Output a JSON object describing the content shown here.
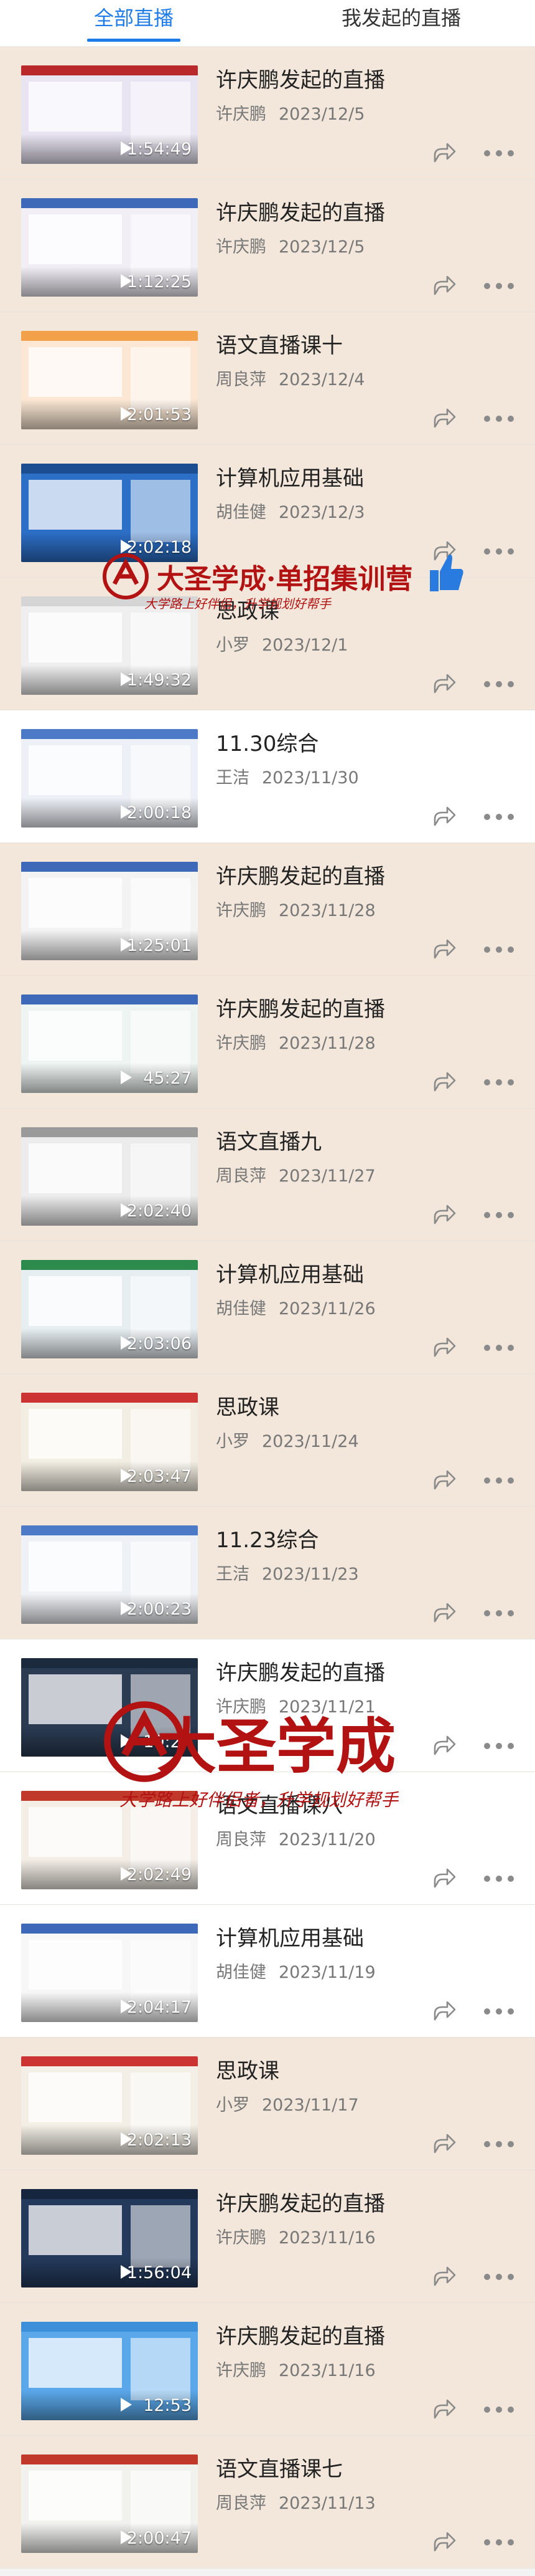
{
  "tabs": [
    {
      "label": "全部直播",
      "active": true
    },
    {
      "label": "我发起的直播",
      "active": false
    }
  ],
  "colors": {
    "accent": "#1e7ce8",
    "item_bg": "#f2e7da",
    "item_bg_alt": "#ffffff",
    "watermark": "#b31212"
  },
  "items": [
    {
      "title": "许庆鹏发起的直播",
      "author": "许庆鹏",
      "date": "2023/12/5",
      "duration": "1:54:49",
      "bg": "#f2e7da",
      "thumb": "#e8e4f2",
      "bar": "#b9292b"
    },
    {
      "title": "许庆鹏发起的直播",
      "author": "许庆鹏",
      "date": "2023/12/5",
      "duration": "1:12:25",
      "bg": "#f2e7da",
      "thumb": "#f1eef6",
      "bar": "#3d69b8"
    },
    {
      "title": "语文直播课十",
      "author": "周良萍",
      "date": "2023/12/4",
      "duration": "2:01:53",
      "bg": "#f2e7da",
      "thumb": "#fbe7d3",
      "bar": "#f3a04b"
    },
    {
      "title": "计算机应用基础",
      "author": "胡佳健",
      "date": "2023/12/3",
      "duration": "2:02:18",
      "bg": "#f2e7da",
      "thumb": "#2c6fc7",
      "bar": "#1c4d91"
    },
    {
      "title": "思政课",
      "author": "小罗",
      "date": "2023/12/1",
      "duration": "1:49:32",
      "bg": "#f2e7da",
      "thumb": "#efefef",
      "bar": "#d5d5d5"
    },
    {
      "title": "11.30综合",
      "author": "王洁",
      "date": "2023/11/30",
      "duration": "2:00:18",
      "bg": "#ffffff",
      "thumb": "#edf1f7",
      "bar": "#4c7ac7"
    },
    {
      "title": "许庆鹏发起的直播",
      "author": "许庆鹏",
      "date": "2023/11/28",
      "duration": "1:25:01",
      "bg": "#f2e7da",
      "thumb": "#f3f3f3",
      "bar": "#3d69b8"
    },
    {
      "title": "许庆鹏发起的直播",
      "author": "许庆鹏",
      "date": "2023/11/28",
      "duration": "45:27",
      "bg": "#f2e7da",
      "thumb": "#eef4f2",
      "bar": "#3d69b8"
    },
    {
      "title": "语文直播九",
      "author": "周良萍",
      "date": "2023/11/27",
      "duration": "2:02:40",
      "bg": "#f2e7da",
      "thumb": "#ececec",
      "bar": "#9a9a9a"
    },
    {
      "title": "计算机应用基础",
      "author": "胡佳健",
      "date": "2023/11/26",
      "duration": "2:03:06",
      "bg": "#f2e7da",
      "thumb": "#e7eef2",
      "bar": "#2c8a4c"
    },
    {
      "title": "思政课",
      "author": "小罗",
      "date": "2023/11/24",
      "duration": "2:03:47",
      "bg": "#f2e7da",
      "thumb": "#f3eee3",
      "bar": "#cc3333"
    },
    {
      "title": "11.23综合",
      "author": "王洁",
      "date": "2023/11/23",
      "duration": "2:00:23",
      "bg": "#f2e7da",
      "thumb": "#eef1f5",
      "bar": "#4c7ac7"
    },
    {
      "title": "许庆鹏发起的直播",
      "author": "许庆鹏",
      "date": "2023/11/21",
      "duration": "10:27",
      "bg": "#ffffff",
      "thumb": "#2a3b52",
      "bar": "#1b2a3d"
    },
    {
      "title": "语文直播课八",
      "author": "周良萍",
      "date": "2023/11/20",
      "duration": "2:02:49",
      "bg": "#ffffff",
      "thumb": "#f4eee6",
      "bar": "#c0392b"
    },
    {
      "title": "计算机应用基础",
      "author": "胡佳健",
      "date": "2023/11/19",
      "duration": "2:04:17",
      "bg": "#ffffff",
      "thumb": "#f7f7f7",
      "bar": "#3d69b8"
    },
    {
      "title": "思政课",
      "author": "小罗",
      "date": "2023/11/17",
      "duration": "2:02:13",
      "bg": "#f2e7da",
      "thumb": "#f3efe6",
      "bar": "#cc3333"
    },
    {
      "title": "许庆鹏发起的直播",
      "author": "许庆鹏",
      "date": "2023/11/16",
      "duration": "1:56:04",
      "bg": "#f2e7da",
      "thumb": "#243a5c",
      "bar": "#16263f"
    },
    {
      "title": "许庆鹏发起的直播",
      "author": "许庆鹏",
      "date": "2023/11/16",
      "duration": "12:53",
      "bg": "#f2e7da",
      "thumb": "#5aa8ea",
      "bar": "#3d8fd9"
    },
    {
      "title": "语文直播课七",
      "author": "周良萍",
      "date": "2023/11/13",
      "duration": "2:00:47",
      "bg": "#f2e7da",
      "thumb": "#f1f1ee",
      "bar": "#c0392b"
    }
  ],
  "watermarks": [
    {
      "title": "大圣学成·单招集训营",
      "subtitle": "大学路上好伴侣，升学规划好帮手"
    },
    {
      "title": "大圣学成",
      "subtitle": "大学路上好伴侣者，升学规划好帮手"
    }
  ]
}
